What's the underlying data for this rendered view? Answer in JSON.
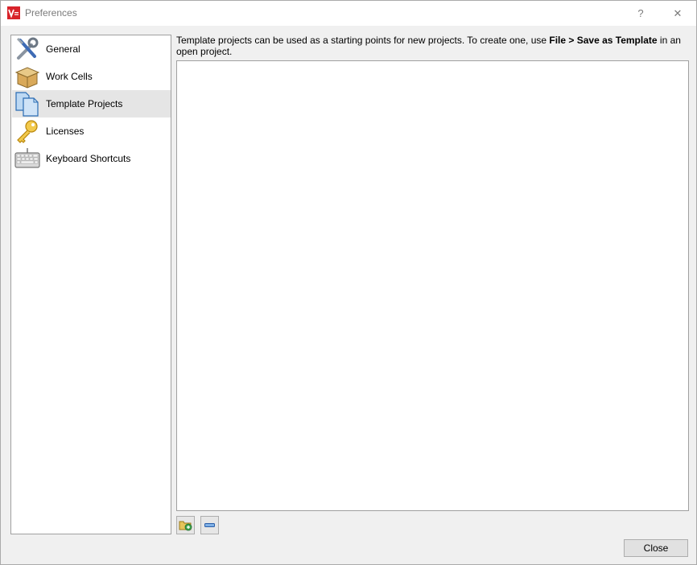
{
  "window": {
    "title": "Preferences",
    "help_label": "?",
    "close_glyph": "✕"
  },
  "sidebar": {
    "items": [
      {
        "label": "General",
        "icon": "tools-icon",
        "selected": false
      },
      {
        "label": "Work Cells",
        "icon": "box-icon",
        "selected": false
      },
      {
        "label": "Template Projects",
        "icon": "documents-icon",
        "selected": true
      },
      {
        "label": "Licenses",
        "icon": "key-icon",
        "selected": false
      },
      {
        "label": "Keyboard Shortcuts",
        "icon": "keyboard-icon",
        "selected": false
      }
    ]
  },
  "main": {
    "description_prefix": "Template projects can be used as a starting points for new projects. To create one, use ",
    "description_bold": "File > Save as Template",
    "description_suffix": " in an open project.",
    "templates": []
  },
  "buttons": {
    "close_label": "Close",
    "add_icon": "add-folder-icon",
    "remove_icon": "remove-icon"
  },
  "colors": {
    "accent_red": "#d8232a",
    "selected_bg": "#e5e5e5"
  }
}
